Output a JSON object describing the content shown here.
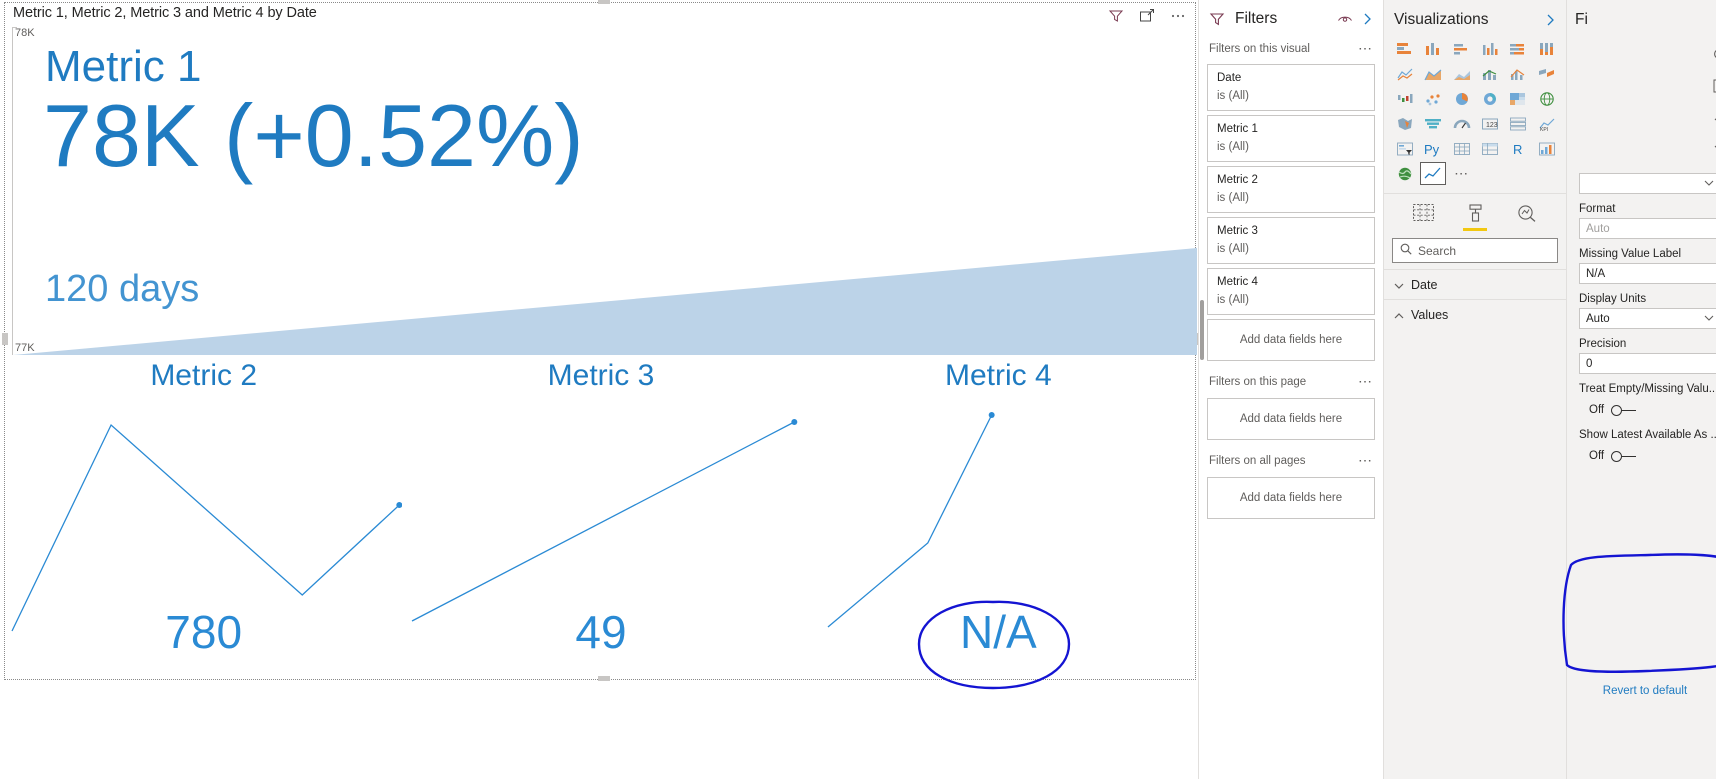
{
  "report": {
    "visual_title": "Metric 1, Metric 2, Metric 3 and Metric 4 by Date",
    "header_icons": [
      "filter-icon",
      "focus-mode-icon",
      "more-options-icon"
    ],
    "axis": {
      "top_label": "78K",
      "bottom_label": "77K"
    },
    "kpi_main": {
      "name": "Metric 1",
      "value": "78K (+0.52%)",
      "subtitle": "120 days"
    },
    "kpi_cards": [
      {
        "name": "Metric 2",
        "value": "780"
      },
      {
        "name": "Metric 3",
        "value": "49"
      },
      {
        "name": "Metric 4",
        "value": "N/A"
      }
    ],
    "annotation": {
      "circled_value": "N/A"
    }
  },
  "chart_data": {
    "type": "line",
    "title": "Metric 1, Metric 2, Metric 3 and Metric 4 by Date",
    "xlabel": "Date",
    "ylabel": "",
    "ylim": [
      77000,
      78000
    ],
    "ytick_labels": [
      "78K",
      "77K"
    ],
    "grid": false,
    "legend": "none",
    "series": [
      {
        "name": "Metric 1",
        "display": "area",
        "latest_value": 78000,
        "latest_value_label": "78K",
        "change_label": "(+0.52%)",
        "period_label": "120 days",
        "x": [
          0,
          1,
          2,
          3,
          4,
          5,
          6
        ],
        "values": [
          77000,
          77180,
          77340,
          77520,
          77680,
          77850,
          78000
        ]
      },
      {
        "name": "Metric 2",
        "display": "sparkline",
        "latest_value": 780,
        "latest_value_label": "780",
        "x": [
          0,
          1,
          2,
          3,
          4
        ],
        "values": [
          12,
          93,
          52,
          18,
          60
        ]
      },
      {
        "name": "Metric 3",
        "display": "sparkline",
        "latest_value": 49,
        "latest_value_label": "49",
        "x": [
          0,
          1
        ],
        "values": [
          10,
          88
        ]
      },
      {
        "name": "Metric 4",
        "display": "sparkline",
        "latest_value": null,
        "latest_value_label": "N/A",
        "x": [
          0,
          1,
          2
        ],
        "values": [
          8,
          46,
          90
        ]
      }
    ]
  },
  "filters_pane": {
    "title": "Filters",
    "header_icons": [
      "eye-hide-icon",
      "collapse-chevron-icon"
    ],
    "sections": [
      {
        "label": "Filters on this visual",
        "menu_icon": "more-options-icon",
        "cards": [
          {
            "field": "Date",
            "condition": "is (All)"
          },
          {
            "field": "Metric 1",
            "condition": "is (All)"
          },
          {
            "field": "Metric 2",
            "condition": "is (All)"
          },
          {
            "field": "Metric 3",
            "condition": "is (All)"
          },
          {
            "field": "Metric 4",
            "condition": "is (All)"
          }
        ],
        "dropzone": "Add data fields here"
      },
      {
        "label": "Filters on this page",
        "menu_icon": "more-options-icon",
        "cards": [],
        "dropzone": "Add data fields here"
      },
      {
        "label": "Filters on all pages",
        "menu_icon": "more-options-icon",
        "cards": [],
        "dropzone": "Add data fields here"
      }
    ]
  },
  "visualizations_pane": {
    "title": "Visualizations",
    "collapse_icon": "collapse-chevron-icon",
    "gallery": [
      "stacked-bar-chart-icon",
      "stacked-column-chart-icon",
      "clustered-bar-chart-icon",
      "clustered-column-chart-icon",
      "hundred-stacked-bar-icon",
      "hundred-stacked-column-icon",
      "line-chart-icon",
      "area-chart-icon",
      "stacked-area-chart-icon",
      "line-stacked-column-icon",
      "line-clustered-column-icon",
      "ribbon-chart-icon",
      "waterfall-chart-icon",
      "scatter-chart-icon",
      "pie-chart-icon",
      "donut-chart-icon",
      "treemap-icon",
      "map-icon",
      "filled-map-icon",
      "funnel-chart-icon",
      "gauge-icon",
      "card-icon",
      "multi-row-card-icon",
      "kpi-icon",
      "slicer-icon",
      "python-visual-icon",
      "table-icon",
      "matrix-icon",
      "r-script-visual-icon",
      "key-influencers-icon",
      "arcgis-map-icon",
      "line-kpi-custom-visual-icon",
      "more-visuals-icon"
    ],
    "selected_visual": "line-kpi-custom-visual-icon",
    "tabs": [
      {
        "name": "fields-tab",
        "icon": "fields-grid-icon",
        "active": false
      },
      {
        "name": "format-tab",
        "icon": "paint-roller-icon",
        "active": true
      },
      {
        "name": "analytics-tab",
        "icon": "magnifier-chart-icon",
        "active": false
      }
    ],
    "search": {
      "placeholder": "Search",
      "value": "",
      "icon": "search-icon"
    },
    "wells": [
      {
        "label": "Date",
        "chevron": "chevron-down-icon"
      },
      {
        "label": "Values",
        "chevron": "chevron-up-icon"
      }
    ]
  },
  "format_pane": {
    "title": "Fi",
    "side_icons": [
      "search-icon",
      "expand-icon",
      "chevron-up-icon",
      "chevron-down-icon"
    ],
    "fields": [
      {
        "label": "",
        "type": "dropdown",
        "value": "",
        "placeholder": ""
      },
      {
        "label": "Format",
        "type": "text",
        "value": "",
        "placeholder": "Auto"
      },
      {
        "label": "Missing Value Label",
        "type": "text",
        "value": "N/A",
        "placeholder": ""
      },
      {
        "label": "Display Units",
        "type": "dropdown",
        "value": "Auto",
        "placeholder": ""
      },
      {
        "label": "Precision",
        "type": "text",
        "value": "0",
        "placeholder": ""
      }
    ],
    "toggles": [
      {
        "label": "Treat Empty/Missing Valu...",
        "state": "Off"
      },
      {
        "label": "Show Latest Available As ...",
        "state": "Off"
      }
    ],
    "revert_label": "Revert to default",
    "annotation": "blue-ink-box-around-toggles"
  },
  "colors": {
    "accent_blue": "#1f7bc1",
    "kpi_blue": "#2a8ad4",
    "area_fill": "#bcd3e8",
    "ink_annotation": "#1414d2",
    "pane_bg": "#f3f2f1",
    "border": "#c8c6c4",
    "yellow_tab": "#f2c811"
  }
}
